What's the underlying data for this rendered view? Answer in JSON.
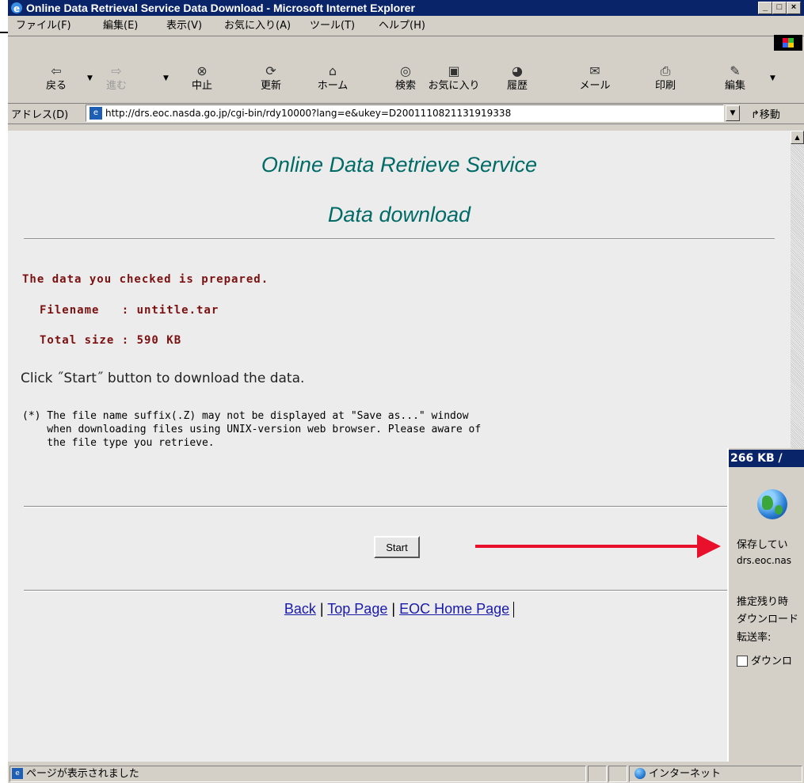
{
  "window": {
    "title": "Online Data Retrieval Service Data Download - Microsoft Internet Explorer",
    "controls": [
      "_",
      "□",
      "×"
    ]
  },
  "menu": [
    "ファイル(F)",
    "編集(E)",
    "表示(V)",
    "お気に入り(A)",
    "ツール(T)",
    "ヘルプ(H)"
  ],
  "toolbar": {
    "back": {
      "label": "戻る",
      "icon": "back-arrow-icon"
    },
    "forward": {
      "label": "進む",
      "icon": "forward-arrow-icon"
    },
    "stop": {
      "label": "中止",
      "icon": "stop-icon"
    },
    "refresh": {
      "label": "更新",
      "icon": "refresh-icon"
    },
    "home": {
      "label": "ホーム",
      "icon": "home-icon"
    },
    "search": {
      "label": "検索",
      "icon": "search-icon"
    },
    "favorites": {
      "label": "お気に入り",
      "icon": "favorites-icon"
    },
    "history": {
      "label": "履歴",
      "icon": "history-icon"
    },
    "mail": {
      "label": "メール",
      "icon": "mail-icon"
    },
    "print": {
      "label": "印刷",
      "icon": "print-icon"
    },
    "edit": {
      "label": "編集",
      "icon": "edit-icon"
    }
  },
  "address": {
    "label": "アドレス(D)",
    "url": "http://drs.eoc.nasda.go.jp/cgi-bin/rdy10000?lang=e&ukey=D2001110821131919338",
    "go_label": "移動"
  },
  "page": {
    "title_line1": "Online Data Retrieve Service",
    "title_line2": "Data download",
    "prepared_msg": "The data you checked is prepared.",
    "filename_line": "Filename   : untitle.tar",
    "size_line": "Total size : 590 KB",
    "instruction": "Click ˝Start˝ button to download the data.",
    "note": "(*) The file name suffix(.Z) may not be displayed at \"Save as...\" window\n    when downloading files using UNIX-version web browser. Please aware of\n    the file type you retrieve.",
    "start_button": "Start",
    "links": [
      "Back",
      "Top Page",
      "EOC Home Page"
    ],
    "separator": "|"
  },
  "download_dialog": {
    "title": "266 KB / ",
    "saving": "保存してい",
    "source": "drs.eoc.nas",
    "estimated": "推定残り時",
    "download_to": "ダウンロード",
    "rate": "転送率:",
    "checkbox_label": "ダウンロ"
  },
  "status": {
    "message": "ページが表示されました",
    "zone": "インターネット"
  },
  "colors": {
    "title_bar": "#0a246a",
    "heading": "#006b66",
    "mono_red": "#7b1010",
    "link": "#1a1aa8",
    "arrow": "#e8102a"
  }
}
